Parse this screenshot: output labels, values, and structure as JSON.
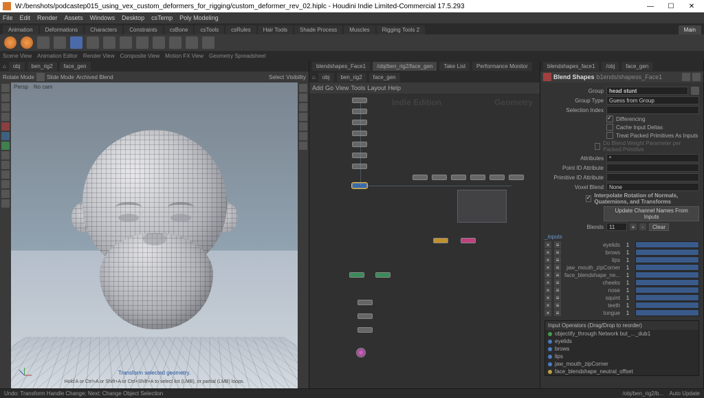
{
  "window": {
    "title": "W:/benshots/podcastep015_using_vex_custom_deformers_for_rigging/custom_deformer_rev_02.hiplc - Houdini Indie Limited-Commercial 17.5.293",
    "minimize": "—",
    "maximize": "☐",
    "close": "✕"
  },
  "menu": [
    "File",
    "Edit",
    "Render",
    "Assets",
    "Windows",
    "Desktop",
    "csTemp",
    "Poly Modeling"
  ],
  "shelf_tabs": [
    "Animation",
    "Deformations",
    "Characters",
    "Constraints",
    "csBone",
    "csTools",
    "csRules",
    "Hair Tools",
    "Shade Process",
    "Muscles",
    "Rigging Tools 2"
  ],
  "shelf_right": "Main",
  "sub_tabs": [
    "Scene View",
    "Animation Editor",
    "Render View",
    "Composite View",
    "Motion FX View",
    "Geometry Spreadsheet"
  ],
  "viewport": {
    "breadcrumb": [
      "obj",
      "ben_rig2",
      "face_gen"
    ],
    "rotate": "Rotate Mode",
    "slide": "Slide Mode",
    "archived": "Archived Blend",
    "select": "Select",
    "visibility": "Visibility",
    "persp": "Persp",
    "no_cam": "No cam",
    "hint1": "Transform selected geometry.",
    "hint2": "Hold A or Ctrl+A or Shift+A or Ctrl+Shift+A to select list (LMB), or partial (LMB) loops."
  },
  "network": {
    "tabs": [
      "blendshapes_Face1",
      "/obj/ben_rig2/face_gen",
      "Take List",
      "Performance Monitor"
    ],
    "breadcrumb": [
      "obj",
      "ben_rig2",
      "face_gen"
    ],
    "menu": [
      "Add",
      "Go",
      "View",
      "Tools",
      "Layout",
      "Help"
    ],
    "wm_left": "Indie Edition",
    "wm_right": "Geometry"
  },
  "params": {
    "tabs": [
      "blendshapes_face1",
      "/obj",
      "face_gen"
    ],
    "operator": "Blend Shapes",
    "path": "b1ends/shapess_Face1",
    "group_lbl": "Group",
    "group_val": "head stunt",
    "group_type_lbl": "Group Type",
    "group_type_val": "Guess from Group",
    "selection_lbl": "Selection Index",
    "differencing_lbl": "Differencing",
    "cache_lbl": "Cache Input Deltas",
    "packed_lbl": "Treat Packed Primitives As Inputs",
    "weightparam_lbl": "Do Blend Weight Parameter per Packed Primitive",
    "attributes_lbl": "Attributes",
    "pointid_lbl": "Point ID Attribute",
    "primid_lbl": "Primitive ID Attribute",
    "voxel_lbl": "Voxel Blend",
    "voxel_val": "None",
    "interp_lbl": "Interpolate Rotation of Normals, Quaternions, and Transforms",
    "update_btn": "Update Channel Names From Inputs",
    "blends_lbl": "Blends",
    "blends_count": "11",
    "blends_clear": "Clear",
    "inputs_header": "Input Operators  (Drag/Drop to reorder)",
    "input_hdr": "_inputs",
    "sliders": [
      {
        "label": "eyelids",
        "value": "1"
      },
      {
        "label": "brows",
        "value": "1"
      },
      {
        "label": "lips",
        "value": "1"
      },
      {
        "label": "jaw_mouth_zipCorner",
        "value": "1"
      },
      {
        "label": "face_blendshape_ne...",
        "value": "1"
      },
      {
        "label": "cheeks",
        "value": "1"
      },
      {
        "label": "nose",
        "value": "1"
      },
      {
        "label": "squint",
        "value": "1"
      },
      {
        "label": "teeth",
        "value": "1"
      },
      {
        "label": "tongue",
        "value": "1"
      }
    ],
    "inputs": [
      {
        "color": "g",
        "label": "objectify_through Network but_..._dub1"
      },
      {
        "color": "b",
        "label": "eyelids"
      },
      {
        "color": "b",
        "label": "brows"
      },
      {
        "color": "b",
        "label": "lips"
      },
      {
        "color": "b",
        "label": "jaw_mouth_zipCorner"
      },
      {
        "color": "y",
        "label": "face_blendshape_neutral_offset"
      }
    ]
  },
  "status": {
    "left": "Undo: Transform Handle Change; Next: Change Object Selection",
    "path": "/obj/ben_rig2/b...",
    "update": "Auto Update"
  }
}
